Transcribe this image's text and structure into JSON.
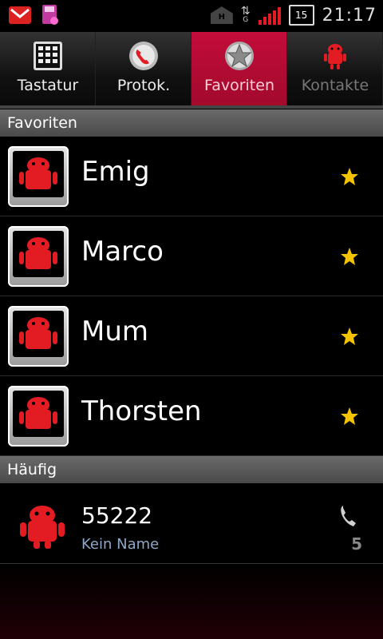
{
  "status_bar": {
    "time": "21:17",
    "network_label": "H",
    "data_type": "G",
    "battery_level": "15",
    "left_icons": [
      "gmail-icon",
      "sd-card-icon"
    ],
    "signal_color": "#e31c24"
  },
  "tabs": [
    {
      "label": "Tastatur",
      "icon": "keypad-icon",
      "active": false
    },
    {
      "label": "Protok.",
      "icon": "phone-log-icon",
      "active": false
    },
    {
      "label": "Favoriten",
      "icon": "star-icon",
      "active": true
    },
    {
      "label": "Kontakte",
      "icon": "android-contact-icon",
      "active": false
    }
  ],
  "favorites": {
    "header": "Favoriten",
    "items": [
      {
        "name": "Emig"
      },
      {
        "name": "Marco"
      },
      {
        "name": "Mum"
      },
      {
        "name": "Thorsten"
      }
    ]
  },
  "frequent": {
    "header": "Häufig",
    "items": [
      {
        "number": "55222",
        "subtitle": "Kein Name",
        "count": "5"
      }
    ]
  },
  "colors": {
    "accent": "#c30c3a",
    "star": "#f5c400",
    "android_red": "#e31c24"
  }
}
